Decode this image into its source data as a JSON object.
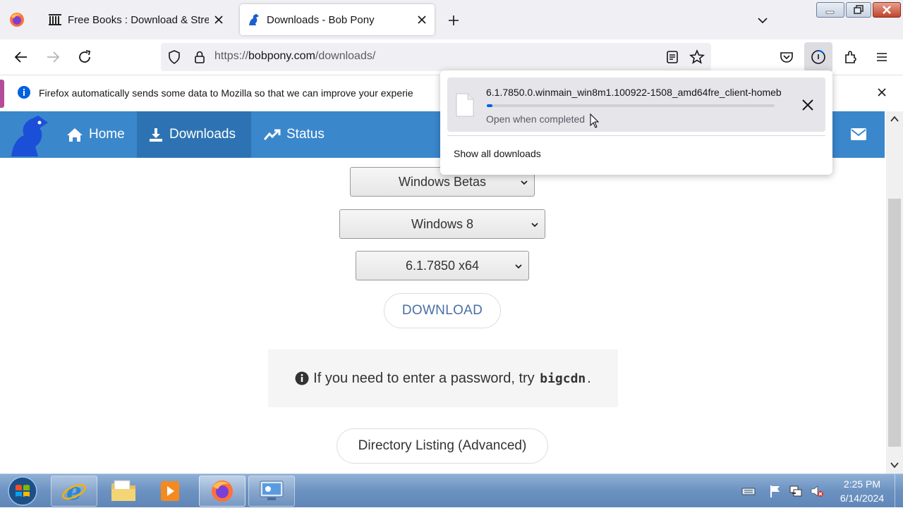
{
  "browser": {
    "tabs": [
      {
        "title": "Free Books : Download & Strea",
        "active": false
      },
      {
        "title": "Downloads - Bob Pony",
        "active": true
      }
    ],
    "url": {
      "prefix": "https://",
      "domain": "bobpony.com",
      "path": "/downloads/"
    }
  },
  "notification": {
    "text": "Firefox automatically sends some data to Mozilla so that we can improve your experie"
  },
  "site": {
    "nav": {
      "home": "Home",
      "downloads": "Downloads",
      "status": "Status"
    },
    "selects": {
      "category": "Windows Betas",
      "os": "Windows 8",
      "build": "6.1.7850 x64"
    },
    "download_button": "DOWNLOAD",
    "password_note": {
      "before": "If you need to enter a password, try",
      "code": "bigcdn",
      "after": "."
    },
    "directory_button": "Directory Listing (Advanced)"
  },
  "downloads_panel": {
    "filename": "6.1.7850.0.winmain_win8m1.100922-1508_amd64fre_client-homeb",
    "status": "Open when completed",
    "progress": 0.02,
    "show_all": "Show all downloads"
  },
  "taskbar": {
    "time": "2:25 PM",
    "date": "6/14/2024"
  },
  "colors": {
    "site_nav": "#3a87cc",
    "site_nav_active": "#2d73b3",
    "progress": "#0061e0"
  }
}
